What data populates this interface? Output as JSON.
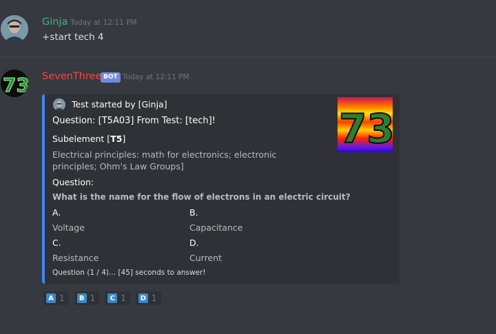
{
  "messages": [
    {
      "author": "Ginja",
      "author_color": "#43b581",
      "timestamp": "Today at 12:11 PM",
      "text": "+start tech 4"
    },
    {
      "author": "SevenThree",
      "author_color": "#f04747",
      "badge": "BOT",
      "timestamp": "Today at 12:11 PM"
    }
  ],
  "embed": {
    "border_color": "#4286f4",
    "author": "Test started by [Ginja]",
    "title": "Question: [T5A03] From Test: [tech]!",
    "subelement_prefix": "Subelement [",
    "subelement_code": "T5",
    "subelement_suffix": "]",
    "subelement_desc": "Electrical principles: math for electronics; electronic principles; Ohm's Law Groups]",
    "question_label": "Question:",
    "question_text": "What is the name for the flow of electrons in an electric circuit?",
    "options": [
      {
        "name": "A.",
        "value": "Voltage"
      },
      {
        "name": "B.",
        "value": "Capacitance"
      },
      {
        "name": "C.",
        "value": "Resistance"
      },
      {
        "name": "D.",
        "value": "Current"
      }
    ],
    "footer": "Question (1 / 4)... [45] seconds to answer!"
  },
  "reactions": [
    {
      "emoji": "A",
      "count": "1"
    },
    {
      "emoji": "B",
      "count": "1"
    },
    {
      "emoji": "C",
      "count": "1"
    },
    {
      "emoji": "D",
      "count": "1"
    }
  ]
}
